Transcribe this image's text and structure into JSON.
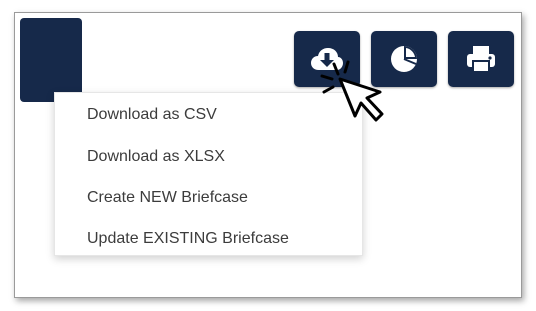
{
  "toolbar": {
    "buttons": [
      {
        "name": "download",
        "icon": "cloud-download-icon"
      },
      {
        "name": "chart",
        "icon": "pie-chart-icon"
      },
      {
        "name": "print",
        "icon": "printer-icon"
      }
    ]
  },
  "menu": {
    "items": [
      {
        "label": "Download as CSV"
      },
      {
        "label": "Download as XLSX"
      },
      {
        "label": "Create NEW Briefcase"
      },
      {
        "label": "Update EXISTING Briefcase"
      }
    ]
  },
  "colors": {
    "button_bg": "#16294a",
    "text": "#3c3c3c",
    "icon": "#ffffff"
  }
}
